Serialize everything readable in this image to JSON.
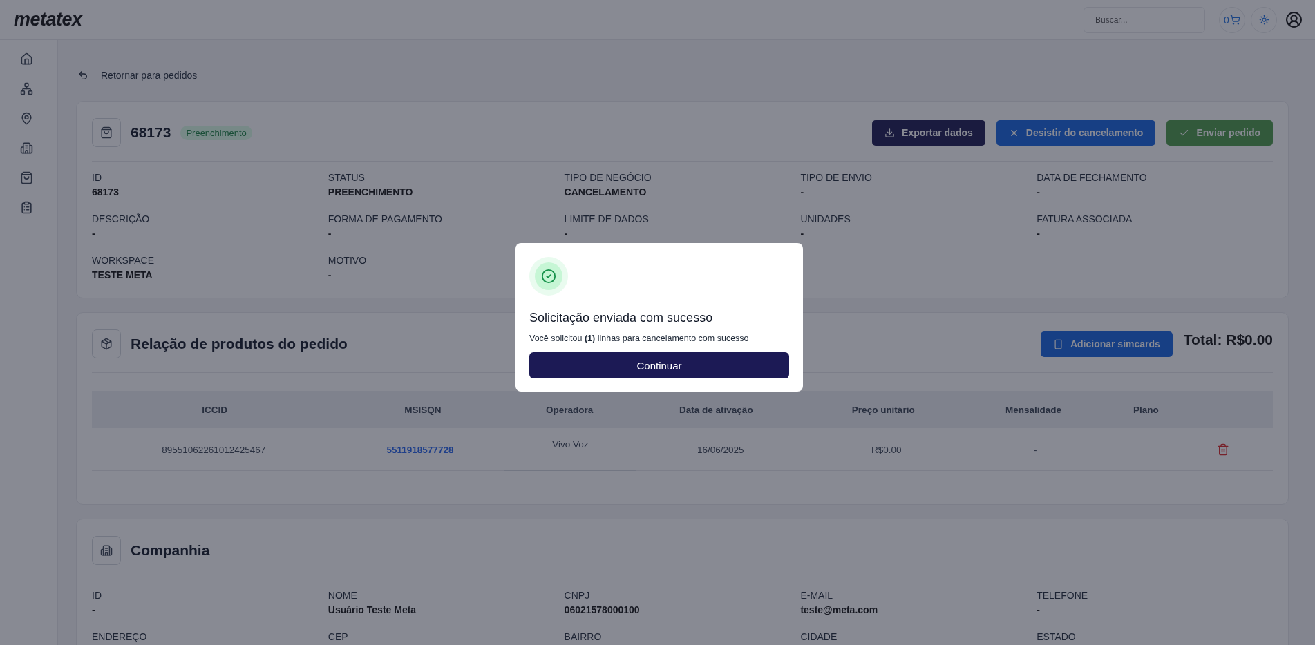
{
  "header": {
    "logo": "metatex",
    "search": {
      "placeholder": "Buscar..."
    },
    "cart_count": "0"
  },
  "back_link": "Retornar para pedidos",
  "order": {
    "number": "68173",
    "status_badge": "Preenchimento",
    "actions": [
      {
        "label": "Exportar dados",
        "kind": "export"
      },
      {
        "label": "Desistir do cancelamento",
        "kind": "cancel"
      },
      {
        "label": "Enviar pedido",
        "kind": "send"
      }
    ],
    "fields": [
      {
        "label": "ID",
        "value": "68173"
      },
      {
        "label": "STATUS",
        "value": "PREENCHIMENTO"
      },
      {
        "label": "TIPO DE NEGÓCIO",
        "value": "CANCELAMENTO"
      },
      {
        "label": "TIPO DE ENVIO",
        "value": "-"
      },
      {
        "label": "DATA DE FECHAMENTO",
        "value": "-"
      },
      {
        "label": "DESCRIÇÃO",
        "value": "-"
      },
      {
        "label": "FORMA DE PAGAMENTO",
        "value": "-"
      },
      {
        "label": "LIMITE DE DADOS",
        "value": "-"
      },
      {
        "label": "UNIDADES",
        "value": "-"
      },
      {
        "label": "FATURA ASSOCIADA",
        "value": "-"
      },
      {
        "label": "WORKSPACE",
        "value": "TESTE META"
      },
      {
        "label": "MOTIVO",
        "value": "-"
      }
    ]
  },
  "products": {
    "title": "Relação de produtos do pedido",
    "add_button": "Adicionar simcards",
    "total": "Total: R$0.00",
    "columns": [
      "ICCID",
      "MSISQN",
      "Operadora",
      "Data de ativação",
      "Preço unitário",
      "Mensalidade",
      "Plano"
    ],
    "rows": [
      {
        "iccid": "89551062261012425467",
        "msisdn": "5511918577728",
        "operator": "Vivo Voz",
        "activation_date": "16/06/2025",
        "unit_price": "R$0.00",
        "monthly": "-"
      }
    ]
  },
  "company": {
    "title": "Companhia",
    "fields": [
      {
        "label": "ID",
        "value": "-"
      },
      {
        "label": "NOME",
        "value": "Usuário Teste Meta"
      },
      {
        "label": "CNPJ",
        "value": "06021578000100"
      },
      {
        "label": "E-MAIL",
        "value": "teste@meta.com"
      },
      {
        "label": "TELEFONE",
        "value": "-"
      },
      {
        "label": "ENDEREÇO"
      },
      {
        "label": "CEP"
      },
      {
        "label": "BAIRRO"
      },
      {
        "label": "CIDADE"
      },
      {
        "label": "ESTADO"
      }
    ]
  },
  "modal": {
    "title": "Solicitação enviada com sucesso",
    "message": "Você solicitou **(1)** linhas para cancelamento com sucesso",
    "button": "Continuar"
  }
}
